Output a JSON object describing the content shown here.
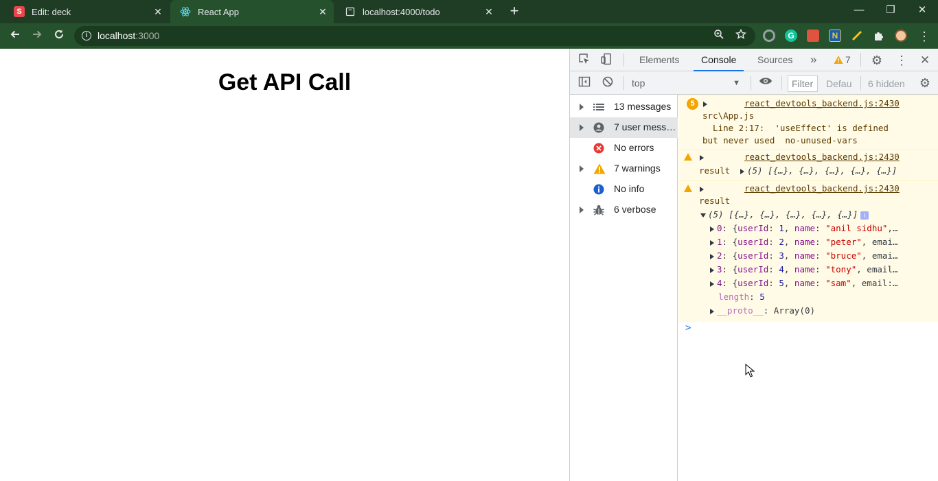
{
  "browser": {
    "tabs": [
      {
        "title": "Edit: deck",
        "favicon": "S",
        "favicon_color": "#e8474b"
      },
      {
        "title": "React App",
        "favicon": "react-icon",
        "favicon_color": "#61dafb"
      },
      {
        "title": "localhost:4000/todo",
        "favicon": "page-icon",
        "favicon_color": "#e8eaed"
      }
    ],
    "new_tab": "+",
    "window_controls": {
      "minimize": "—",
      "restore": "❐",
      "close": "✕"
    },
    "url_host": "localhost",
    "url_port": ":3000",
    "extensions": [
      "ext-circle-icon",
      "grammarly-icon",
      "ext-red-icon",
      "ext-blue-icon",
      "ext-pencil-icon",
      "puzzle-icon",
      "avatar"
    ]
  },
  "page": {
    "heading": "Get API Call"
  },
  "devtools": {
    "tabs": [
      "Elements",
      "Console",
      "Sources"
    ],
    "active_tab": "Console",
    "more": "»",
    "warning_count": "7",
    "context": "top",
    "filter_placeholder": "Filter",
    "levels": "Defau",
    "hidden": "6 hidden",
    "sidebar": [
      {
        "label": "13 messages",
        "icon": "list-icon",
        "expandable": true
      },
      {
        "label": "7 user mess…",
        "icon": "user-icon",
        "expandable": true,
        "selected": true
      },
      {
        "label": "No errors",
        "icon": "error-icon",
        "expandable": false
      },
      {
        "label": "7 warnings",
        "icon": "warning-icon",
        "expandable": true
      },
      {
        "label": "No info",
        "icon": "info-icon",
        "expandable": false
      },
      {
        "label": "6 verbose",
        "icon": "bug-icon",
        "expandable": true
      }
    ],
    "console": {
      "msg1": {
        "badge": "5",
        "source": "react_devtools_backend.js:2430",
        "file": "src\\App.js",
        "line1": "  Line 2:17:  'useEffect' is defined",
        "line2": "but never used  no-unused-vars"
      },
      "msg2": {
        "source": "react_devtools_backend.js:2430",
        "label": "result",
        "summary": "(5) [{…}, {…}, {…}, {…}, {…}]"
      },
      "msg3": {
        "source": "react_devtools_backend.js:2430",
        "label": "result",
        "summary": "(5) [{…}, {…}, {…}, {…}, {…}]",
        "items": [
          {
            "idx": "0",
            "id": "1",
            "name": "\"anil sidhu\"",
            "rest": ",…"
          },
          {
            "idx": "1",
            "id": "2",
            "name": "\"peter\"",
            "rest": ", emai…"
          },
          {
            "idx": "2",
            "id": "3",
            "name": "\"bruce\"",
            "rest": ", emai…"
          },
          {
            "idx": "3",
            "id": "4",
            "name": "\"tony\"",
            "rest": ", email…"
          },
          {
            "idx": "4",
            "id": "5",
            "name": "\"sam\"",
            "rest": ", email:…"
          }
        ],
        "length_key": "length",
        "length_val": "5",
        "proto_key": "__proto__",
        "proto_val": "Array(0)"
      },
      "prompt": ">"
    }
  }
}
